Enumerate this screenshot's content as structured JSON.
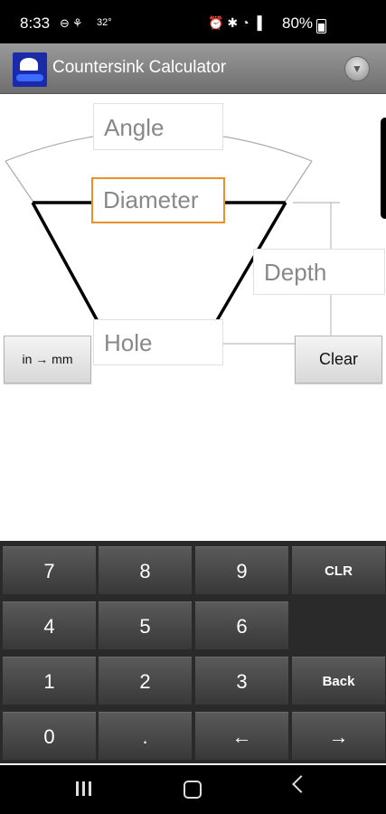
{
  "status": {
    "time": "8:33",
    "temp": "32°",
    "battery": "80%"
  },
  "app": {
    "title": "Countersink Calculator"
  },
  "fields": {
    "angle_placeholder": "Angle",
    "diameter_placeholder": "Diameter",
    "depth_placeholder": "Depth",
    "hole_placeholder": "Hole"
  },
  "buttons": {
    "convert": "in → mm",
    "clear": "Clear"
  },
  "keypad": {
    "keys": [
      "7",
      "8",
      "9",
      "CLR",
      "4",
      "5",
      "6",
      "",
      "1",
      "2",
      "3",
      "Back",
      "0",
      ".",
      "←",
      "→"
    ]
  }
}
